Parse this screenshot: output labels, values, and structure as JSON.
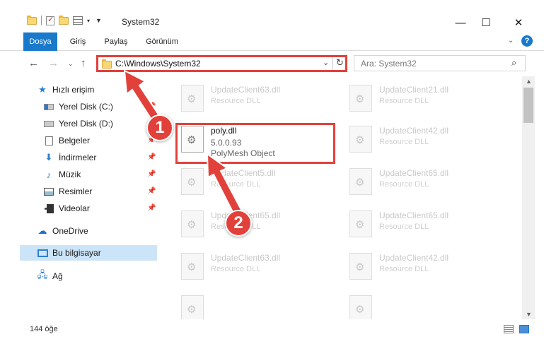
{
  "window": {
    "title": "System32"
  },
  "ribbon": {
    "tabs": [
      {
        "label": "Dosya",
        "active": true
      },
      {
        "label": "Giriş"
      },
      {
        "label": "Paylaş"
      },
      {
        "label": "Görünüm"
      }
    ]
  },
  "address": {
    "path": "C:\\Windows\\System32"
  },
  "search": {
    "placeholder": "Ara: System32"
  },
  "sidebar": {
    "items": [
      {
        "label": "Hızlı erişim"
      },
      {
        "label": "Yerel Disk (C:)"
      },
      {
        "label": "Yerel Disk (D:)"
      },
      {
        "label": "Belgeler"
      },
      {
        "label": "İndirmeler"
      },
      {
        "label": "Müzik"
      },
      {
        "label": "Resimler"
      },
      {
        "label": "Videolar"
      },
      {
        "label": "OneDrive"
      },
      {
        "label": "Bu bilgisayar"
      },
      {
        "label": "Ağ"
      }
    ]
  },
  "files": {
    "highlighted": {
      "name": "poly.dll",
      "version": "5.0.0.93",
      "description": "PolyMesh Object"
    },
    "others": [
      {
        "name": "UpdateClient63.dll",
        "type": "Resource DLL"
      },
      {
        "name": "UpdateClient21.dll",
        "type": "Resource DLL"
      },
      {
        "name": "UpdateClient42.dll",
        "type": "Resource DLL"
      },
      {
        "name": "UpdateClient5.dll",
        "type": "Resource DLL"
      },
      {
        "name": "UpdateClient65.dll",
        "type": "Resource DLL"
      },
      {
        "name": "UpdateClient65.dll",
        "type": "Resource DLL"
      },
      {
        "name": "UpdateClient65.dll",
        "type": "Resource DLL"
      },
      {
        "name": "UpdateClient63.dll",
        "type": "Resource DLL"
      },
      {
        "name": "UpdateClient42.dll",
        "type": "Resource DLL"
      }
    ]
  },
  "status": {
    "item_count": "144 öğe"
  },
  "annotations": {
    "step1": "1",
    "step2": "2"
  },
  "colors": {
    "accent": "#1979ca",
    "highlight": "#e2413b"
  }
}
